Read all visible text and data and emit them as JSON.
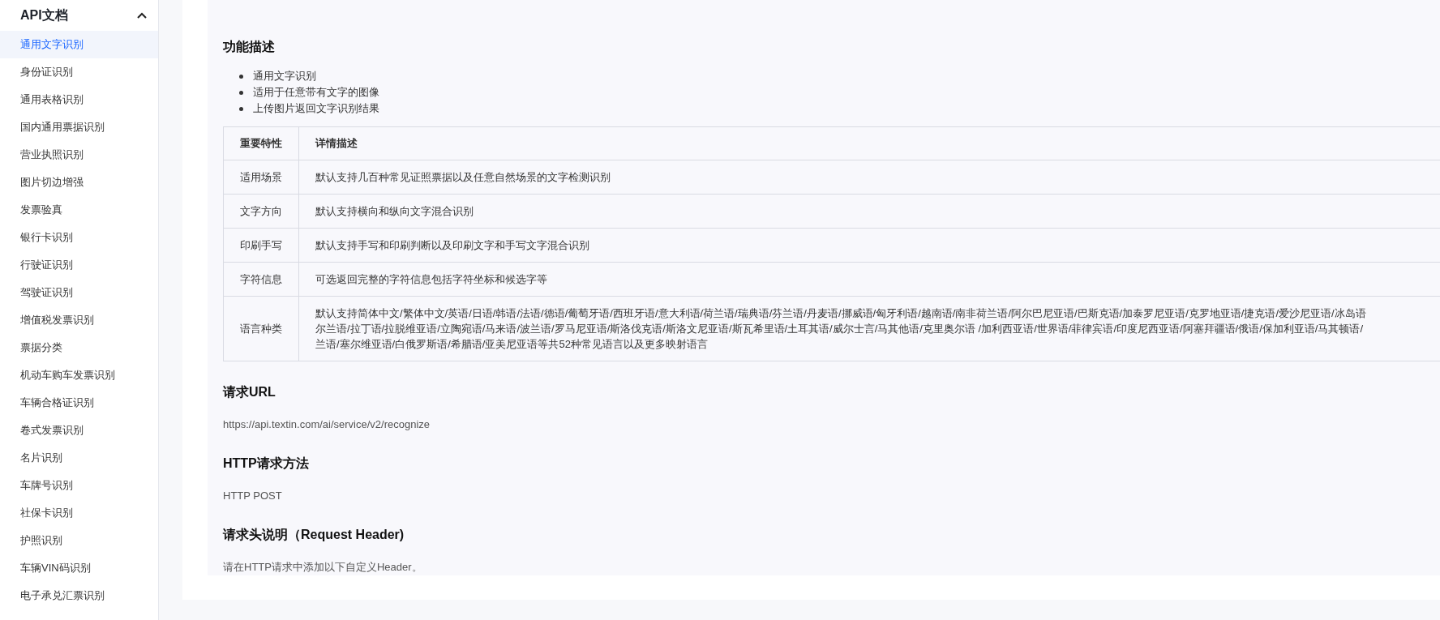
{
  "sidebar": {
    "title": "API文档",
    "expanded": true,
    "items": [
      {
        "label": "通用文字识别",
        "selected": true
      },
      {
        "label": "身份证识别",
        "selected": false
      },
      {
        "label": "通用表格识别",
        "selected": false
      },
      {
        "label": "国内通用票据识别",
        "selected": false
      },
      {
        "label": "营业执照识别",
        "selected": false
      },
      {
        "label": "图片切边增强",
        "selected": false
      },
      {
        "label": "发票验真",
        "selected": false
      },
      {
        "label": "银行卡识别",
        "selected": false
      },
      {
        "label": "行驶证识别",
        "selected": false
      },
      {
        "label": "驾驶证识别",
        "selected": false
      },
      {
        "label": "增值税发票识别",
        "selected": false
      },
      {
        "label": "票据分类",
        "selected": false
      },
      {
        "label": "机动车购车发票识别",
        "selected": false
      },
      {
        "label": "车辆合格证识别",
        "selected": false
      },
      {
        "label": "卷式发票识别",
        "selected": false
      },
      {
        "label": "名片识别",
        "selected": false
      },
      {
        "label": "车牌号识别",
        "selected": false
      },
      {
        "label": "社保卡识别",
        "selected": false
      },
      {
        "label": "护照识别",
        "selected": false
      },
      {
        "label": "车辆VIN码识别",
        "selected": false
      },
      {
        "label": "电子承兑汇票识别",
        "selected": false
      }
    ]
  },
  "content": {
    "description": {
      "heading": "功能描述",
      "bullets": [
        "通用文字识别",
        "适用于任意带有文字的图像",
        "上传图片返回文字识别结果"
      ]
    },
    "table": {
      "columns": [
        "重要特性",
        "详情描述"
      ],
      "rows": [
        {
          "feature": "适用场景",
          "detail": [
            "默认支持几百种常见证照票据以及任意自然场景的文字检测识别"
          ]
        },
        {
          "feature": "文字方向",
          "detail": [
            "默认支持横向和纵向文字混合识别"
          ]
        },
        {
          "feature": "印刷手写",
          "detail": [
            "默认支持手写和印刷判断以及印刷文字和手写文字混合识别"
          ]
        },
        {
          "feature": "字符信息",
          "detail": [
            "可选返回完整的字符信息包括字符坐标和候选字等"
          ]
        },
        {
          "feature": "语言种类",
          "detail": [
            "默认支持简体中文/繁体中文/英语/日语/韩语/法语/德语/葡萄牙语/西班牙语/意大利语/荷兰语/瑞典语/芬兰语/丹麦语/挪威语/匈牙利语/越南语/南非荷兰语/阿尔巴尼亚语/巴斯克语/加泰罗尼亚语/克罗地亚语/捷克语/爱沙尼亚语/冰岛语",
            "尔兰语/拉丁语/拉脱维亚语/立陶宛语/马来语/波兰语/罗马尼亚语/斯洛伐克语/斯洛文尼亚语/斯瓦希里语/土耳其语/威尔士言/马其他语/克里奥尔语 /加利西亚语/世界语/菲律宾语/印度尼西亚语/阿塞拜疆语/俄语/保加利亚语/马其顿语/",
            "兰语/塞尔维亚语/白俄罗斯语/希腊语/亚美尼亚语等共52种常见语言以及更多映射语言"
          ]
        }
      ]
    },
    "sections": [
      {
        "heading": "请求URL",
        "text": "https://api.textin.com/ai/service/v2/recognize"
      },
      {
        "heading": "HTTP请求方法",
        "text": "HTTP POST"
      },
      {
        "heading": "请求头说明（Request Header)",
        "text": "请在HTTP请求中添加以下自定义Header。"
      }
    ]
  }
}
